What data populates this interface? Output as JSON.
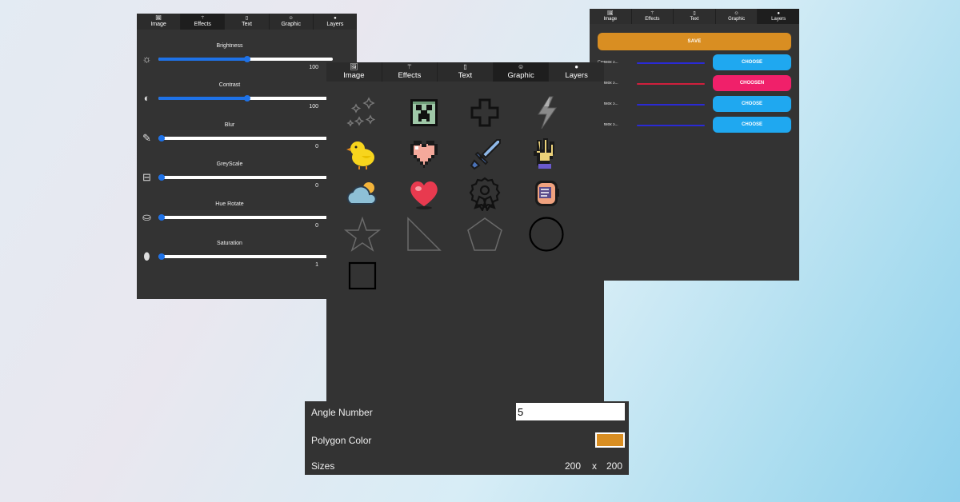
{
  "tab_labels": [
    "Image",
    "Effects",
    "Text",
    "Graphic",
    "Layers"
  ],
  "tab_icons": [
    "🖼",
    "⚚",
    "▯",
    "☺",
    "●"
  ],
  "effects": {
    "sliders": [
      {
        "label": "Brightness",
        "value": "100",
        "fraction": 0.51,
        "icon": "sun-icon",
        "glyph": "☼"
      },
      {
        "label": "Contrast",
        "value": "100",
        "fraction": 0.51,
        "icon": "contrast-icon",
        "glyph": "◐"
      },
      {
        "label": "Blur",
        "value": "0",
        "fraction": 0.0,
        "icon": "brush-icon",
        "glyph": "✎"
      },
      {
        "label": "GreyScale",
        "value": "0",
        "fraction": 0.0,
        "icon": "container-icon",
        "glyph": "⊟"
      },
      {
        "label": "Hue Rotate",
        "value": "0",
        "fraction": 0.0,
        "icon": "paint-bucket-icon",
        "glyph": "⛀"
      },
      {
        "label": "Saturation",
        "value": "1",
        "fraction": 0.0,
        "icon": "droplet-icon",
        "glyph": "⬮"
      }
    ]
  },
  "layers": {
    "save_label": "SAVE",
    "rows": [
      {
        "name": "Снимок э...",
        "line_color": "#2a2ad6",
        "button": "CHOOSE",
        "button_color": "#1fa8f0"
      },
      {
        "name": "Снимок э...",
        "line_color": "#d01f3c",
        "button": "CHOOSEN",
        "button_color": "#f0206a"
      },
      {
        "name": "Снимок э...",
        "line_color": "#2a2ad6",
        "button": "CHOOSE",
        "button_color": "#1fa8f0"
      },
      {
        "name": "Снимок э...",
        "line_color": "#2a2ad6",
        "button": "CHOOSE",
        "button_color": "#1fa8f0"
      }
    ]
  },
  "graphic": {
    "items": [
      "sparkles-icon",
      "creeper-face-icon",
      "cross-outline-icon",
      "lightning-icon",
      "chick-icon",
      "pixel-heart-icon",
      "pixel-sword-icon",
      "pixel-glove-icon",
      "cloud-sun-icon",
      "heart-icon",
      "award-badge-icon",
      "robot-head-icon",
      "star-shape-icon",
      "triangle-shape-icon",
      "pentagon-shape-icon",
      "circle-shape-icon",
      "square-shape-icon"
    ]
  },
  "polygon": {
    "angle_label": "Angle Number",
    "angle_value": "5",
    "color_label": "Polygon Color",
    "color": "#d98e22",
    "sizes_label": "Sizes",
    "width": "200",
    "separator": "x",
    "height": "200"
  },
  "colors": {
    "panel_bg": "#333333",
    "slider_blue": "#1e72e8",
    "save_orange": "#d98e22"
  }
}
